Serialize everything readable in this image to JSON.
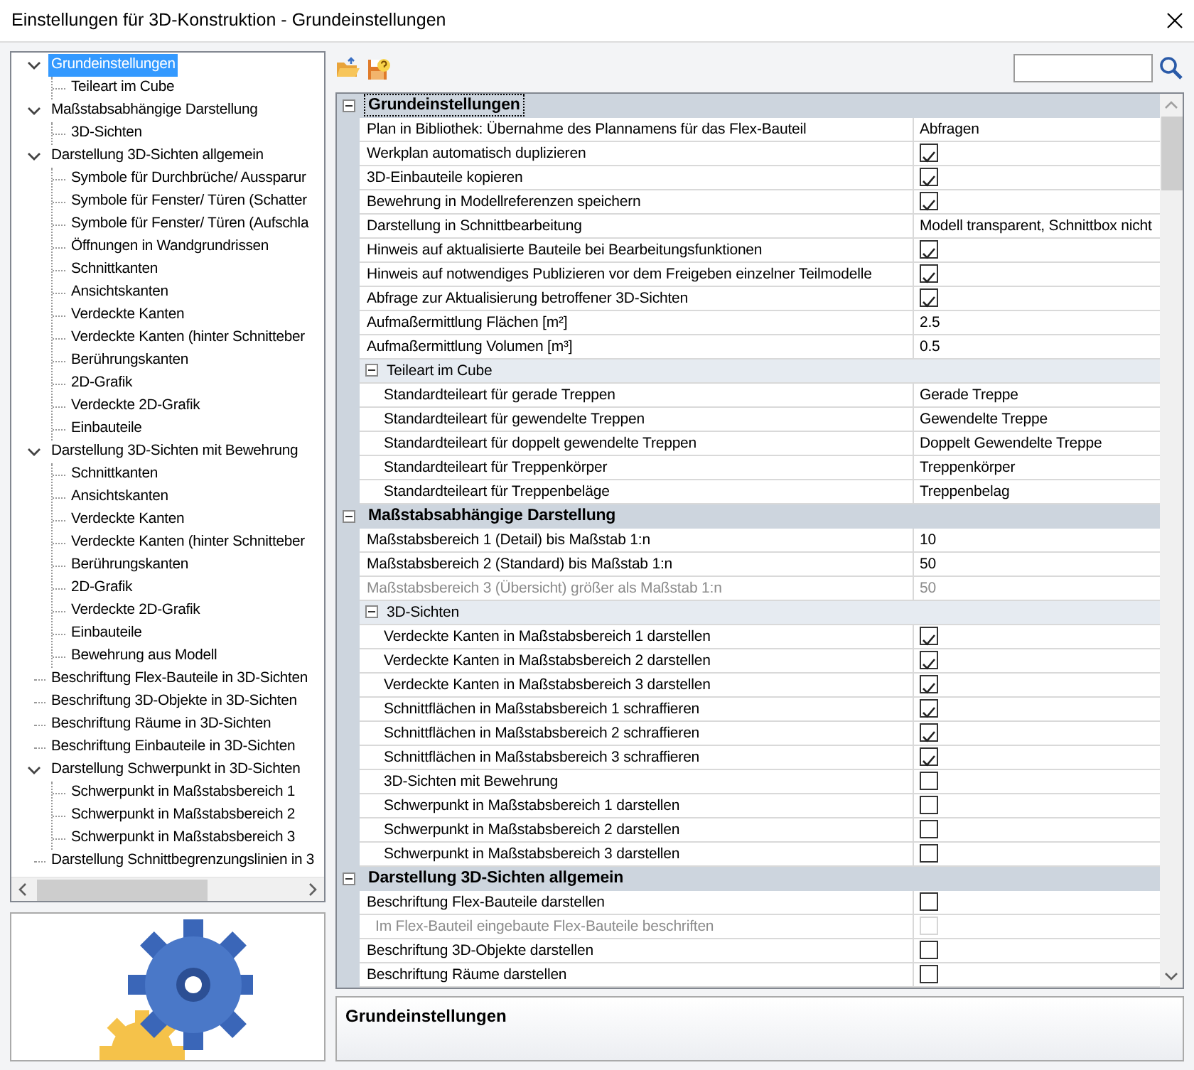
{
  "window": {
    "title": "Einstellungen für 3D-Konstruktion - Grundeinstellungen"
  },
  "tree": {
    "items": [
      {
        "label": "Grundeinstellungen",
        "selected": true,
        "expanded": true,
        "children": [
          {
            "label": "Teileart im Cube",
            "selected": false
          }
        ]
      },
      {
        "label": "Maßstabsabhängige Darstellung",
        "selected": false,
        "expanded": true,
        "children": [
          {
            "label": "3D-Sichten",
            "selected": false
          }
        ]
      },
      {
        "label": "Darstellung 3D-Sichten allgemein",
        "selected": false,
        "expanded": true,
        "children": [
          {
            "label": "Symbole für Durchbrüche/ Aussparur",
            "selected": false
          },
          {
            "label": "Symbole für Fenster/ Türen (Schatter",
            "selected": false
          },
          {
            "label": "Symbole für Fenster/ Türen (Aufschla",
            "selected": false
          },
          {
            "label": "Öffnungen in Wandgrundrissen",
            "selected": false
          },
          {
            "label": "Schnittkanten",
            "selected": false
          },
          {
            "label": "Ansichtskanten",
            "selected": false
          },
          {
            "label": "Verdeckte Kanten",
            "selected": false
          },
          {
            "label": "Verdeckte Kanten (hinter Schnitteber",
            "selected": false
          },
          {
            "label": "Berührungskanten",
            "selected": false
          },
          {
            "label": "2D-Grafik",
            "selected": false
          },
          {
            "label": "Verdeckte 2D-Grafik",
            "selected": false
          },
          {
            "label": "Einbauteile",
            "selected": false
          }
        ]
      },
      {
        "label": "Darstellung 3D-Sichten mit Bewehrung",
        "selected": false,
        "expanded": true,
        "children": [
          {
            "label": "Schnittkanten",
            "selected": false
          },
          {
            "label": "Ansichtskanten",
            "selected": false
          },
          {
            "label": "Verdeckte Kanten",
            "selected": false
          },
          {
            "label": "Verdeckte Kanten (hinter Schnitteber",
            "selected": false
          },
          {
            "label": "Berührungskanten",
            "selected": false
          },
          {
            "label": "2D-Grafik",
            "selected": false
          },
          {
            "label": "Verdeckte 2D-Grafik",
            "selected": false
          },
          {
            "label": "Einbauteile",
            "selected": false
          },
          {
            "label": "Bewehrung aus Modell",
            "selected": false
          }
        ]
      },
      {
        "label": "Beschriftung Flex-Bauteile in 3D-Sichten",
        "selected": false
      },
      {
        "label": "Beschriftung 3D-Objekte in 3D-Sichten",
        "selected": false
      },
      {
        "label": "Beschriftung Räume in 3D-Sichten",
        "selected": false
      },
      {
        "label": "Beschriftung Einbauteile in 3D-Sichten",
        "selected": false
      },
      {
        "label": "Darstellung Schwerpunkt in 3D-Sichten",
        "selected": false,
        "expanded": true,
        "children": [
          {
            "label": "Schwerpunkt in Maßstabsbereich 1",
            "selected": false
          },
          {
            "label": "Schwerpunkt in Maßstabsbereich 2",
            "selected": false
          },
          {
            "label": "Schwerpunkt in Maßstabsbereich 3",
            "selected": false
          }
        ]
      },
      {
        "label": "Darstellung Schnittbegrenzungslinien in 3",
        "selected": false
      }
    ]
  },
  "property_grid": {
    "sections": [
      {
        "title": "Grundeinstellungen",
        "selected": true,
        "expanded": true,
        "rows": [
          {
            "kind": "text",
            "name": "Plan in Bibliothek: Übernahme des Plannamens für das Flex-Bauteil",
            "value": "Abfragen",
            "disabled": false
          },
          {
            "kind": "check",
            "name": "Werkplan automatisch duplizieren",
            "checked": true,
            "disabled": false
          },
          {
            "kind": "check",
            "name": "3D-Einbauteile kopieren",
            "checked": true,
            "disabled": false
          },
          {
            "kind": "check",
            "name": "Bewehrung in Modellreferenzen speichern",
            "checked": true,
            "disabled": false
          },
          {
            "kind": "text",
            "name": "Darstellung in Schnittbearbeitung",
            "value": "Modell transparent, Schnittbox nicht",
            "disabled": false
          },
          {
            "kind": "check",
            "name": "Hinweis auf aktualisierte Bauteile bei Bearbeitungsfunktionen",
            "checked": true,
            "disabled": false
          },
          {
            "kind": "check",
            "name": "Hinweis auf notwendiges Publizieren vor dem Freigeben einzelner Teilmodelle",
            "checked": true,
            "disabled": false
          },
          {
            "kind": "check",
            "name": "Abfrage zur Aktualisierung betroffener 3D-Sichten",
            "checked": true,
            "disabled": false
          },
          {
            "kind": "text",
            "name": "Aufmaßermittlung Flächen [m²]",
            "value": "2.5",
            "disabled": false
          },
          {
            "kind": "text",
            "name": "Aufmaßermittlung Volumen [m³]",
            "value": "0.5",
            "disabled": false
          }
        ],
        "subsections": [
          {
            "title": "Teileart im Cube",
            "selected": false,
            "expanded": true,
            "rows": [
              {
                "kind": "text",
                "name": "Standardteileart für gerade Treppen",
                "value": "Gerade Treppe",
                "disabled": false
              },
              {
                "kind": "text",
                "name": "Standardteileart für gewendelte Treppen",
                "value": "Gewendelte Treppe",
                "disabled": false
              },
              {
                "kind": "text",
                "name": "Standardteileart für doppelt gewendelte Treppen",
                "value": "Doppelt Gewendelte Treppe",
                "disabled": false
              },
              {
                "kind": "text",
                "name": "Standardteileart für Treppenkörper",
                "value": "Treppenkörper",
                "disabled": false
              },
              {
                "kind": "text",
                "name": "Standardteileart für Treppenbeläge",
                "value": "Treppenbelag",
                "disabled": false
              }
            ]
          }
        ]
      },
      {
        "title": "Maßstabsabhängige Darstellung",
        "selected": false,
        "expanded": true,
        "rows": [
          {
            "kind": "text",
            "name": "Maßstabsbereich 1 (Detail) bis Maßstab 1:n",
            "value": "10",
            "disabled": false
          },
          {
            "kind": "text",
            "name": "Maßstabsbereich 2 (Standard) bis Maßstab 1:n",
            "value": "50",
            "disabled": false
          },
          {
            "kind": "text",
            "name": "Maßstabsbereich 3 (Übersicht) größer als Maßstab 1:n",
            "value": "50",
            "disabled": true
          }
        ],
        "subsections": [
          {
            "title": "3D-Sichten",
            "selected": false,
            "expanded": true,
            "rows": [
              {
                "kind": "check",
                "name": "Verdeckte Kanten in Maßstabsbereich 1 darstellen",
                "checked": true,
                "disabled": false
              },
              {
                "kind": "check",
                "name": "Verdeckte Kanten in Maßstabsbereich 2 darstellen",
                "checked": true,
                "disabled": false
              },
              {
                "kind": "check",
                "name": "Verdeckte Kanten in Maßstabsbereich 3 darstellen",
                "checked": true,
                "disabled": false
              },
              {
                "kind": "check",
                "name": "Schnittflächen in Maßstabsbereich 1 schraffieren",
                "checked": true,
                "disabled": false
              },
              {
                "kind": "check",
                "name": "Schnittflächen in Maßstabsbereich 2 schraffieren",
                "checked": true,
                "disabled": false
              },
              {
                "kind": "check",
                "name": "Schnittflächen in Maßstabsbereich 3 schraffieren",
                "checked": true,
                "disabled": false
              },
              {
                "kind": "check",
                "name": "3D-Sichten mit Bewehrung",
                "checked": false,
                "disabled": false
              },
              {
                "kind": "check",
                "name": "Schwerpunkt in Maßstabsbereich 1 darstellen",
                "checked": false,
                "disabled": false
              },
              {
                "kind": "check",
                "name": "Schwerpunkt in Maßstabsbereich 2 darstellen",
                "checked": false,
                "disabled": false
              },
              {
                "kind": "check",
                "name": "Schwerpunkt in Maßstabsbereich 3 darstellen",
                "checked": false,
                "disabled": false
              }
            ]
          }
        ]
      },
      {
        "title": "Darstellung 3D-Sichten allgemein",
        "selected": false,
        "expanded": true,
        "rows": [
          {
            "kind": "check",
            "name": "Beschriftung Flex-Bauteile darstellen",
            "checked": false,
            "disabled": false,
            "children": [
              {
                "kind": "check",
                "name": "Im Flex-Bauteil eingebaute Flex-Bauteile beschriften",
                "checked": false,
                "disabled": true
              }
            ]
          },
          {
            "kind": "check",
            "name": "Beschriftung 3D-Objekte darstellen",
            "checked": false,
            "disabled": false
          },
          {
            "kind": "check",
            "name": "Beschriftung Räume darstellen",
            "checked": false,
            "disabled": false
          }
        ]
      }
    ]
  },
  "description": {
    "title": "Grundeinstellungen"
  }
}
